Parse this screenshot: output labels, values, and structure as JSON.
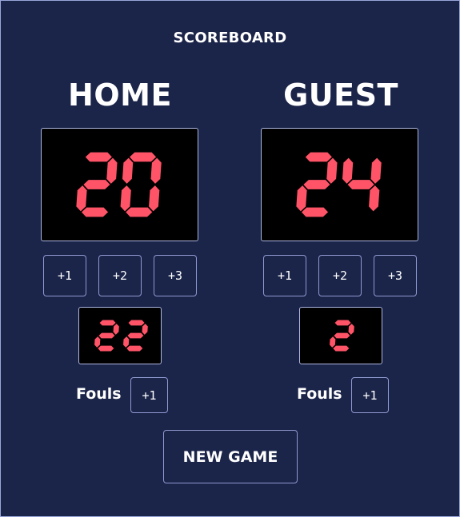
{
  "title": "SCOREBOARD",
  "home": {
    "name": "HOME",
    "score": "20",
    "fouls": "22",
    "add_buttons": [
      "+1",
      "+2",
      "+3"
    ],
    "fouls_label": "Fouls",
    "foul_button": "+1"
  },
  "guest": {
    "name": "GUEST",
    "score": "24",
    "fouls": "2",
    "add_buttons": [
      "+1",
      "+2",
      "+3"
    ],
    "fouls_label": "Fouls",
    "foul_button": "+1"
  },
  "new_game_label": "NEW GAME",
  "colors": {
    "background": "#1b2449",
    "display": "#000000",
    "digit": "#ff5468",
    "border": "#aeb8e3"
  }
}
